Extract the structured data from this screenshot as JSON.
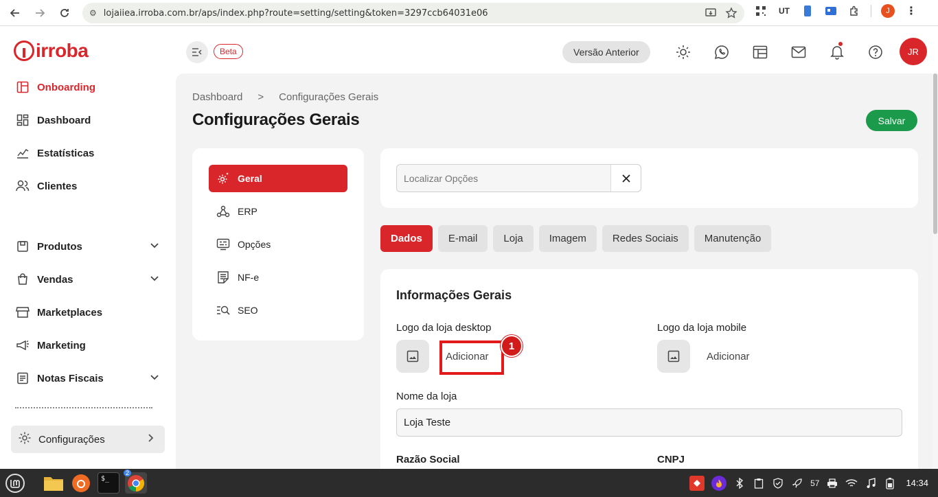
{
  "browser": {
    "url": "lojaiiea.irroba.com.br/aps/index.php?route=setting/setting&token=3297ccb64031e06",
    "profile_initial": "J"
  },
  "brand": {
    "logo_text": "irroba",
    "accent": "#d9262b"
  },
  "sidebar": {
    "items": [
      {
        "label": "Onboarding",
        "icon": "onboarding-icon"
      },
      {
        "label": "Dashboard",
        "icon": "dashboard-icon"
      },
      {
        "label": "Estatísticas",
        "icon": "chart-icon"
      },
      {
        "label": "Clientes",
        "icon": "users-icon"
      },
      {
        "label": "Produtos",
        "icon": "box-icon"
      },
      {
        "label": "Vendas",
        "icon": "bag-icon"
      },
      {
        "label": "Marketplaces",
        "icon": "store-icon"
      },
      {
        "label": "Marketing",
        "icon": "megaphone-icon"
      },
      {
        "label": "Notas Fiscais",
        "icon": "invoice-icon"
      }
    ],
    "config_label": "Configurações"
  },
  "header": {
    "beta_label": "Beta",
    "versao_label": "Versão Anterior",
    "user_initials": "JR"
  },
  "breadcrumb": {
    "home": "Dashboard",
    "separator": ">",
    "current": "Configurações Gerais"
  },
  "page_title": "Configurações Gerais",
  "save_label": "Salvar",
  "settings_nav": [
    {
      "label": "Geral",
      "icon": "gear-sparkle-icon"
    },
    {
      "label": "ERP",
      "icon": "webhook-icon"
    },
    {
      "label": "Opções",
      "icon": "options-icon"
    },
    {
      "label": "NF-e",
      "icon": "nfe-icon"
    },
    {
      "label": "SEO",
      "icon": "seo-icon"
    }
  ],
  "search": {
    "placeholder": "Localizar Opções"
  },
  "tabs": [
    "Dados",
    "E-mail",
    "Loja",
    "Imagem",
    "Redes Sociais",
    "Manutenção"
  ],
  "info": {
    "title": "Informações Gerais",
    "logo_desktop_label": "Logo da loja desktop",
    "logo_mobile_label": "Logo da loja mobile",
    "add_label": "Adicionar",
    "step_number": "1",
    "store_name_label": "Nome da loja",
    "store_name_value": "Loja Teste",
    "razao_label": "Razão Social",
    "cnpj_label": "CNPJ"
  },
  "taskbar": {
    "badge": "2",
    "battery": "57",
    "time": "14:34"
  }
}
